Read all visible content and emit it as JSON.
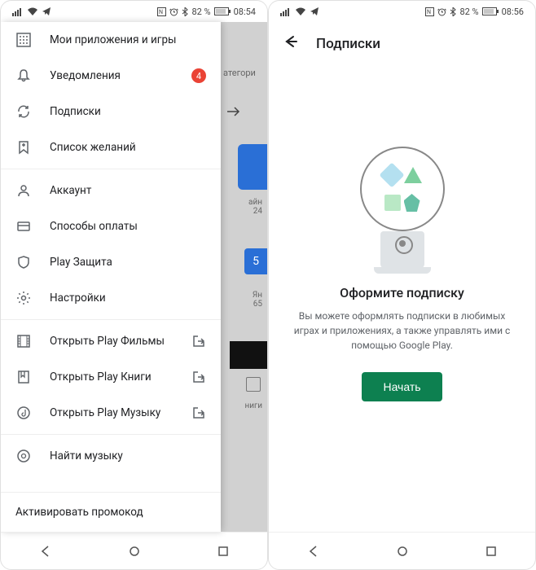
{
  "left": {
    "status_time": "08:54",
    "status_battery": "82 %",
    "menu": {
      "section1": [
        {
          "icon": "grid",
          "label": "Мои приложения и игры"
        },
        {
          "icon": "bell",
          "label": "Уведомления",
          "badge": "4"
        },
        {
          "icon": "refresh",
          "label": "Подписки"
        },
        {
          "icon": "bookmark",
          "label": "Список желаний"
        }
      ],
      "section2": [
        {
          "icon": "user",
          "label": "Аккаунт"
        },
        {
          "icon": "card",
          "label": "Способы оплаты"
        },
        {
          "icon": "shield",
          "label": "Play Защита"
        },
        {
          "icon": "gear",
          "label": "Настройки"
        }
      ],
      "section3": [
        {
          "icon": "film",
          "label": "Открыть Play Фильмы",
          "exit": true
        },
        {
          "icon": "book",
          "label": "Открыть Play Книги",
          "exit": true
        },
        {
          "icon": "music",
          "label": "Открыть Play Музыку",
          "exit": true
        }
      ],
      "section4": [
        {
          "icon": "musicsearch",
          "label": "Найти музыку"
        }
      ],
      "promo": "Активировать промокод"
    },
    "behind": {
      "categories": "атегори",
      "text1": "айн",
      "text2": "24",
      "card": "5",
      "ya": "Ян",
      "n65": "65",
      "knigi": "ниги"
    }
  },
  "right": {
    "status_time": "08:56",
    "status_battery": "82 %",
    "header_title": "Подписки",
    "empty_title": "Оформите подписку",
    "empty_desc": "Вы можете оформлять подписки в любимых играх и приложениях, а также управлять ими с помощью Google Play.",
    "start_button": "Начать"
  }
}
